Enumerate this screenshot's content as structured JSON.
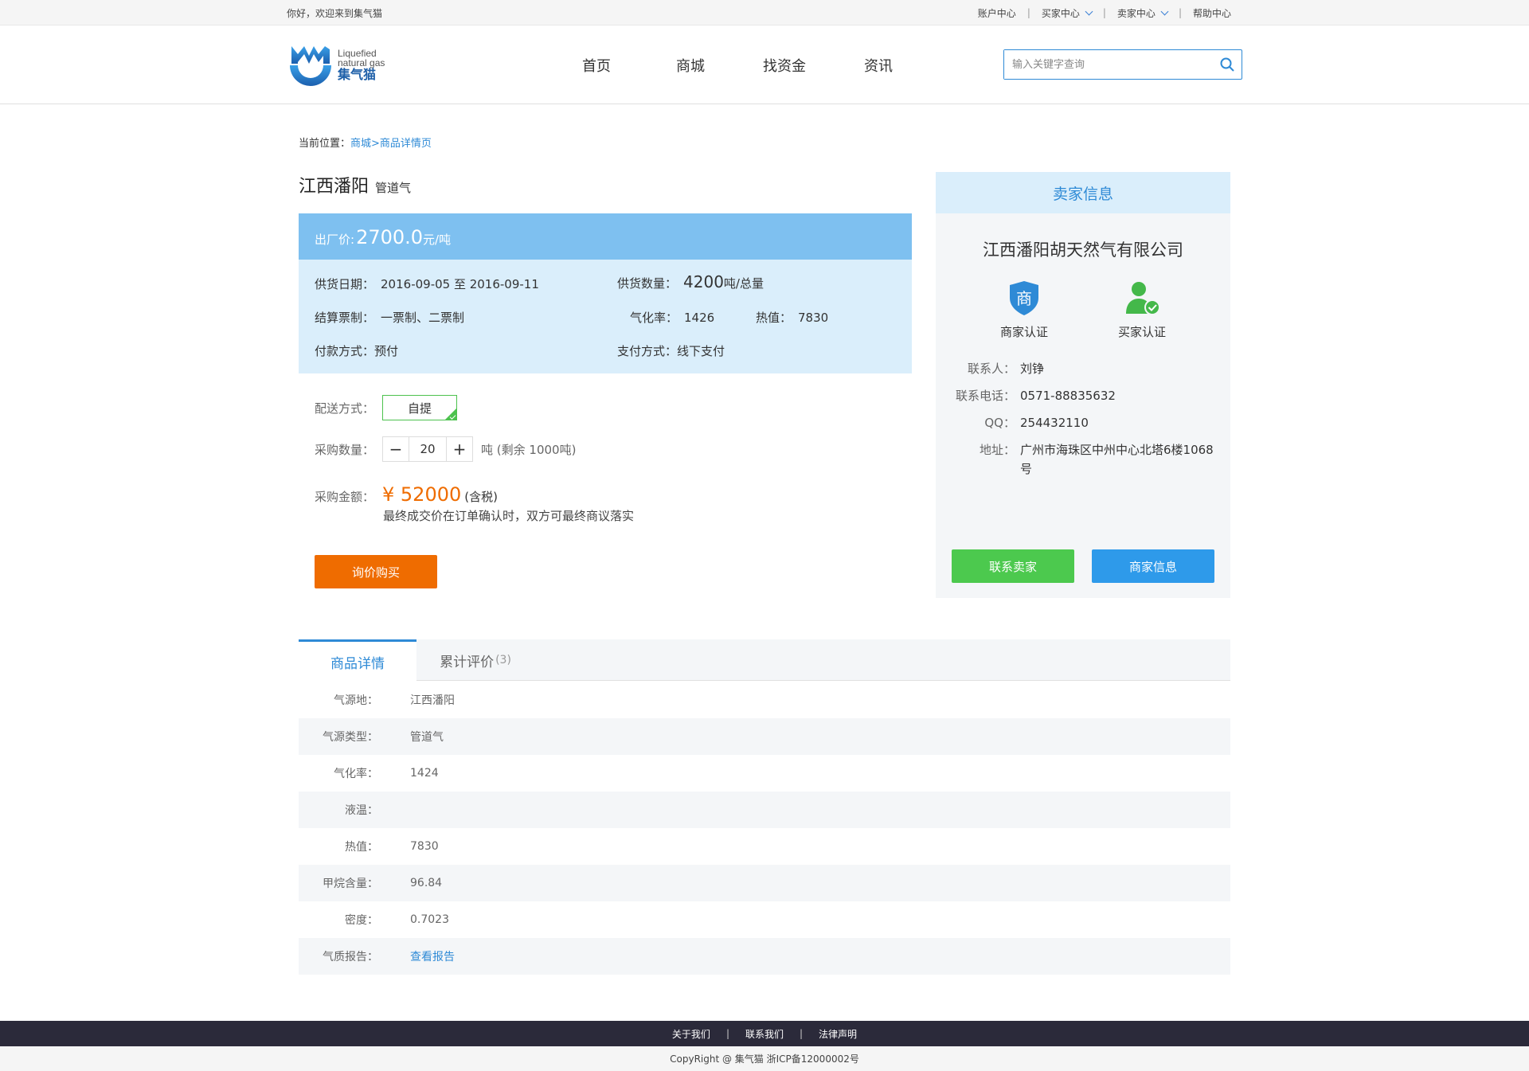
{
  "topbar": {
    "welcome": "你好，欢迎来到集气猫",
    "links": [
      "账户中心",
      "买家中心",
      "卖家中心",
      "帮助中心"
    ],
    "separator": "|"
  },
  "header": {
    "logo_en_1": "Liquefied",
    "logo_en_2": "natural gas",
    "logo_cn": "集气猫",
    "nav": [
      "首页",
      "商城",
      "找资金",
      "资讯"
    ],
    "search_placeholder": "输入关键字查询"
  },
  "breadcrumb": {
    "prefix": "当前位置：",
    "trail": "商城>商品详情页"
  },
  "product": {
    "name": "江西潘阳",
    "type": "管道气",
    "price_label": "出厂价:",
    "price_value": "2700.0",
    "price_unit": "元/吨",
    "supply_date_label": "供货日期：",
    "supply_date_value": "2016-09-05 至 2016-09-11",
    "supply_qty_label": "供货数量：",
    "supply_qty_value": "4200",
    "supply_qty_unit": "吨/总量",
    "settle_label": "结算票制：",
    "settle_value": "一票制、二票制",
    "gasify_label": "气化率：",
    "gasify_value": "1426",
    "heat_label": "热值：",
    "heat_value": "7830",
    "payment_label": "付款方式：",
    "payment_value": "预付",
    "pay_method_label": "支付方式：",
    "pay_method_value": "线下支付",
    "delivery_label": "配送方式：",
    "delivery_option": "自提",
    "qty_label": "采购数量：",
    "qty_minus": "−",
    "qty_value": "20",
    "qty_plus": "+",
    "qty_unit": "吨 (剩余 1000吨)",
    "amount_label": "采购金额：",
    "amount_value": "¥ 52000",
    "amount_tax": "(含税)",
    "amount_note": "最终成交价在订单确认时，双方可最终商议落实",
    "buy_button": "询价购买"
  },
  "seller": {
    "header": "卖家信息",
    "company": "江西潘阳胡天然气有限公司",
    "cert_merchant_icon_text": "商",
    "cert_merchant": "商家认证",
    "cert_buyer": "买家认证",
    "contact_label": "联系人：",
    "contact_value": "刘铮",
    "phone_label": "联系电话：",
    "phone_value": "0571-88835632",
    "qq_label": "QQ：",
    "qq_value": "254432110",
    "address_label": "地址：",
    "address_value": "广州市海珠区中州中心北塔6楼1068号",
    "contact_button": "联系卖家",
    "info_button": "商家信息"
  },
  "tabs": {
    "detail": "商品详情",
    "reviews": "累计评价",
    "reviews_count": "(3)"
  },
  "details": [
    {
      "k": "气源地：",
      "v": "江西潘阳"
    },
    {
      "k": "气源类型：",
      "v": "管道气"
    },
    {
      "k": "气化率：",
      "v": "1424"
    },
    {
      "k": "液温：",
      "v": ""
    },
    {
      "k": "热值：",
      "v": "7830"
    },
    {
      "k": "甲烷含量：",
      "v": "96.84"
    },
    {
      "k": "密度：",
      "v": "0.7023"
    },
    {
      "k": "气质报告：",
      "v": "查看报告"
    }
  ],
  "footer": {
    "links": [
      "关于我们",
      "联系我们",
      "法律声明"
    ],
    "separator": "|",
    "copyright": "CopyRight @ 集气猫 浙ICP备12000002号"
  },
  "colors": {
    "accent_blue": "#2e8ad6",
    "price_bar": "#7ec0f0",
    "info_bg": "#daeefb",
    "orange": "#ef6c00",
    "green": "#4cc94e",
    "footer_dark": "#2b2a3a"
  }
}
